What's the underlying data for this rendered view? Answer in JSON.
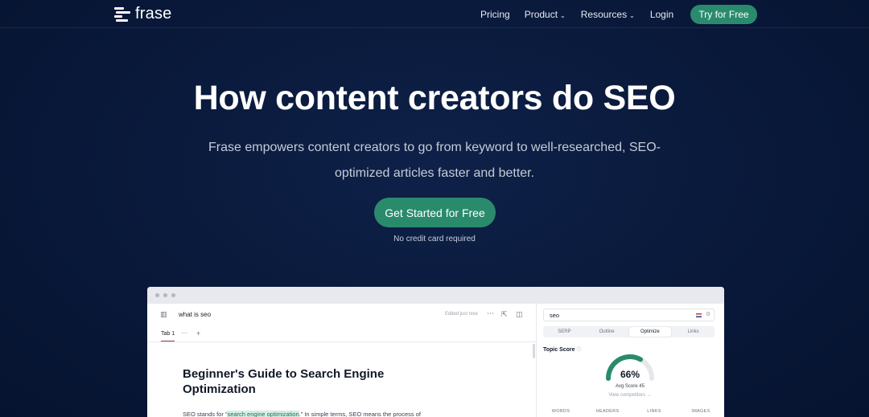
{
  "nav": {
    "logo_text": "frase",
    "links": [
      {
        "label": "Pricing",
        "dropdown": false
      },
      {
        "label": "Product",
        "dropdown": true
      },
      {
        "label": "Resources",
        "dropdown": true
      },
      {
        "label": "Login",
        "dropdown": false
      }
    ],
    "cta_label": "Try for Free"
  },
  "hero": {
    "title": "How content creators do SEO",
    "subtitle": "Frase empowers content creators to go from keyword to well-researched, SEO-optimized articles faster and better.",
    "cta_label": "Get Started for Free",
    "note": "No credit card required"
  },
  "app": {
    "editor": {
      "doc_name": "what is seo",
      "edited_status": "Edited just now",
      "tab_label": "Tab 1",
      "tab_more": "···",
      "tab_add": "+",
      "doc_title": "Beginner's Guide to Search Engine Optimization",
      "body_prefix": "SEO stands for “",
      "body_highlight": "search engine optimization",
      "body_suffix": ".” In simple terms, SEO means the process of"
    },
    "panel": {
      "search_value": "seo",
      "tabs": [
        {
          "label": "SERP",
          "active": false
        },
        {
          "label": "Outline",
          "active": false
        },
        {
          "label": "Optimize",
          "active": true
        },
        {
          "label": "Links",
          "active": false
        }
      ],
      "topic_score_label": "Topic Score",
      "score": "66%",
      "score_fraction": 0.66,
      "avg_score": "Avg Score 45",
      "view_competitors": "View competitors →",
      "metrics": [
        "WORDS",
        "HEADERS",
        "LINKS",
        "IMAGES"
      ]
    }
  },
  "colors": {
    "accent": "#2a8b6c",
    "background": "#0a1a3c",
    "tab_indicator": "#8b3a62"
  }
}
